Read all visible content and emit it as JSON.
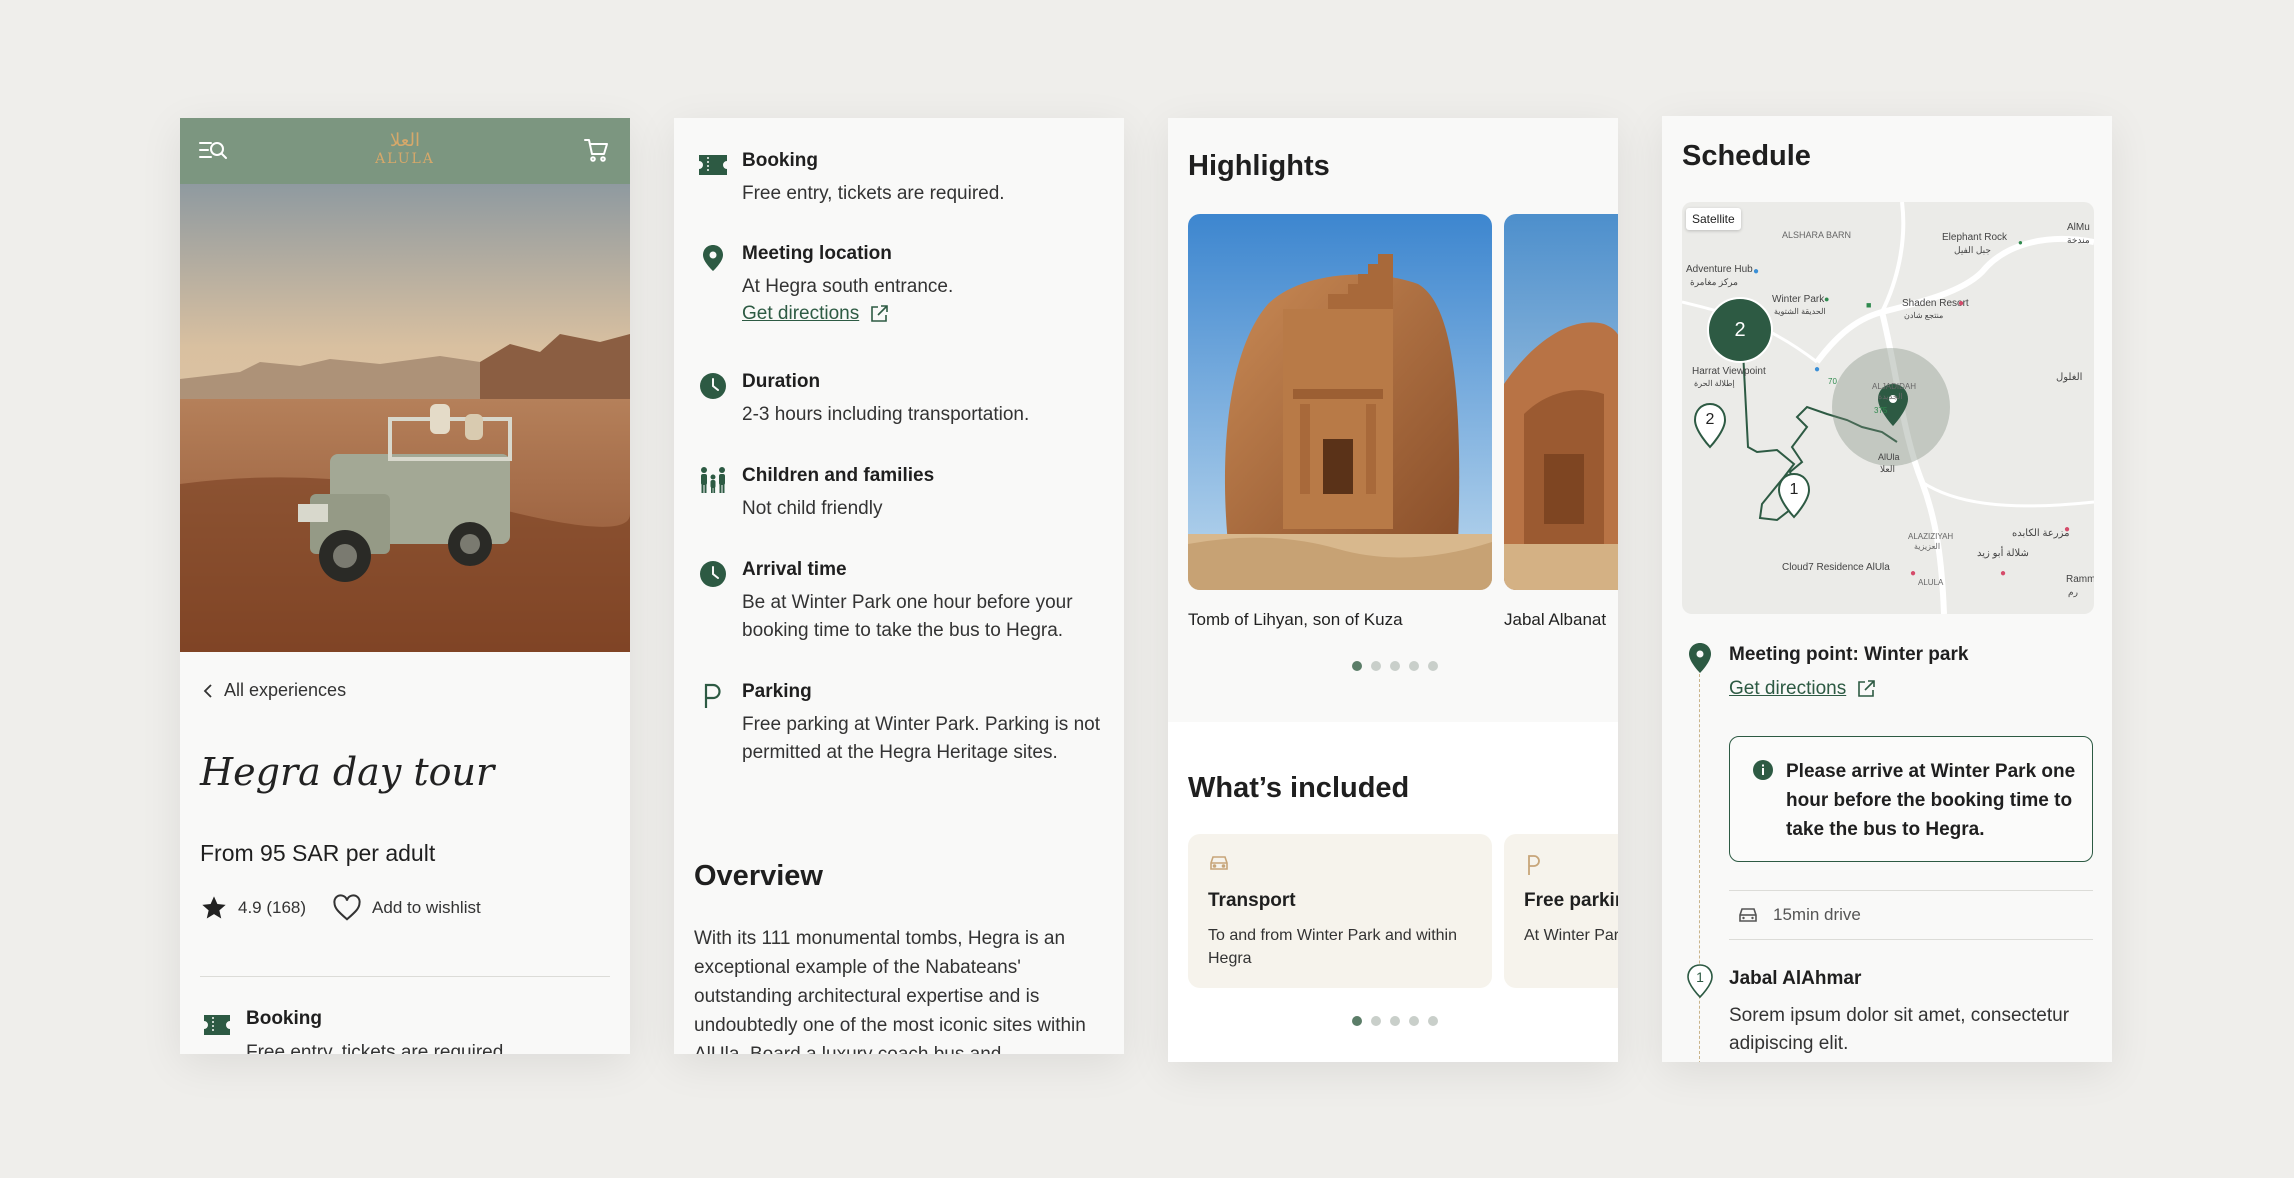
{
  "brand": {
    "logo_ar": "العلا",
    "logo_en": "ALULA"
  },
  "colors": {
    "primary": "#2d5a43",
    "header": "#7c9680",
    "accent": "#d6a86a",
    "card_bg": "#f6f3ec",
    "background": "#efeeeb"
  },
  "detail": {
    "back_label": "All experiences",
    "title": "Hegra day tour",
    "price": "From 95 SAR per adult",
    "rating": "4.9 (168)",
    "wishlist_label": "Add to wishlist",
    "booking": {
      "title": "Booking",
      "text": "Free entry, tickets are required."
    }
  },
  "info": {
    "booking": {
      "title": "Booking",
      "text": "Free entry, tickets are required."
    },
    "meeting": {
      "title": "Meeting location",
      "text": "At Hegra south entrance.",
      "link": "Get directions"
    },
    "duration": {
      "title": "Duration",
      "text": "2-3 hours including transportation."
    },
    "children": {
      "title": "Children and families",
      "text": "Not child friendly"
    },
    "arrival": {
      "title": "Arrival time",
      "text": "Be at Winter Park one hour before your booking time to take the bus to Hegra."
    },
    "parking": {
      "title": "Parking",
      "text": "Free parking at Winter Park. Parking is not permitted at the Hegra Heritage sites."
    },
    "overview_title": "Overview",
    "overview_text": "With its 111 monumental tombs, Hegra is an exceptional example of the Nabateans' outstanding architectural expertise and is undoubtedly one of the most iconic sites within AlUla. Board a luxury coach bus and"
  },
  "highlights": {
    "title": "Highlights",
    "items": [
      {
        "caption": "Tomb of Lihyan, son of Kuza"
      },
      {
        "caption": "Jabal Albanat"
      }
    ],
    "page_count": 5,
    "active_index": 0
  },
  "included": {
    "title": "What’s included",
    "items": [
      {
        "icon": "car-icon",
        "title": "Transport",
        "text": "To and from Winter Park and within Hegra"
      },
      {
        "icon": "parking-icon",
        "title": "Free parking",
        "text": "At Winter Park"
      }
    ],
    "page_count": 5,
    "active_index": 0
  },
  "schedule": {
    "title": "Schedule",
    "map": {
      "satellite_label": "Satellite",
      "cluster_count": "2",
      "pin_a": "2",
      "pin_b": "1",
      "labels": {
        "alshara": "ALSHARA BARN",
        "elephant": "Elephant Rock",
        "elephant_ar": "جبل الفيل",
        "almu": "AlMu",
        "almu_ar": "مندخة",
        "adventure": "Adventure Hub",
        "adventure_ar": "مركز مغامرة",
        "winter": "Winter Park",
        "winter_ar": "الحديقة الشتوية",
        "shaden": "Shaden Resort",
        "shaden_ar": "منتجع شادن",
        "harrat": "Harrat Viewpoint",
        "harrat_ar": "إطلالة الحرة",
        "aljadidah": "ALJADIDAH",
        "aljadidah_ar": "الجديدة",
        "alula": "AlUla",
        "alula_ar": "العلا",
        "alghol": "الغلول",
        "moraa": "مزرعة الكابده",
        "alaziziyah": "ALAZIZIYAH",
        "alaziziyah_ar": "العزيزية",
        "cloud7": "Cloud7 Residence AlUla",
        "shalat": "شلالة أبو زيد",
        "alula2": "ALULA",
        "ramm": "Ramm",
        "ramm_ar": "رم",
        "r375": "375",
        "r70": "70"
      }
    },
    "meeting_title": "Meeting point: Winter park",
    "directions_label": "Get directions",
    "notice": "Please arrive at Winter Park one hour before the booking time to take the bus to Hegra.",
    "drive": "15min drive",
    "stop": {
      "number": "1",
      "title": "Jabal AlAhmar",
      "text": "Sorem ipsum dolor sit amet, consectetur adipiscing elit."
    }
  }
}
